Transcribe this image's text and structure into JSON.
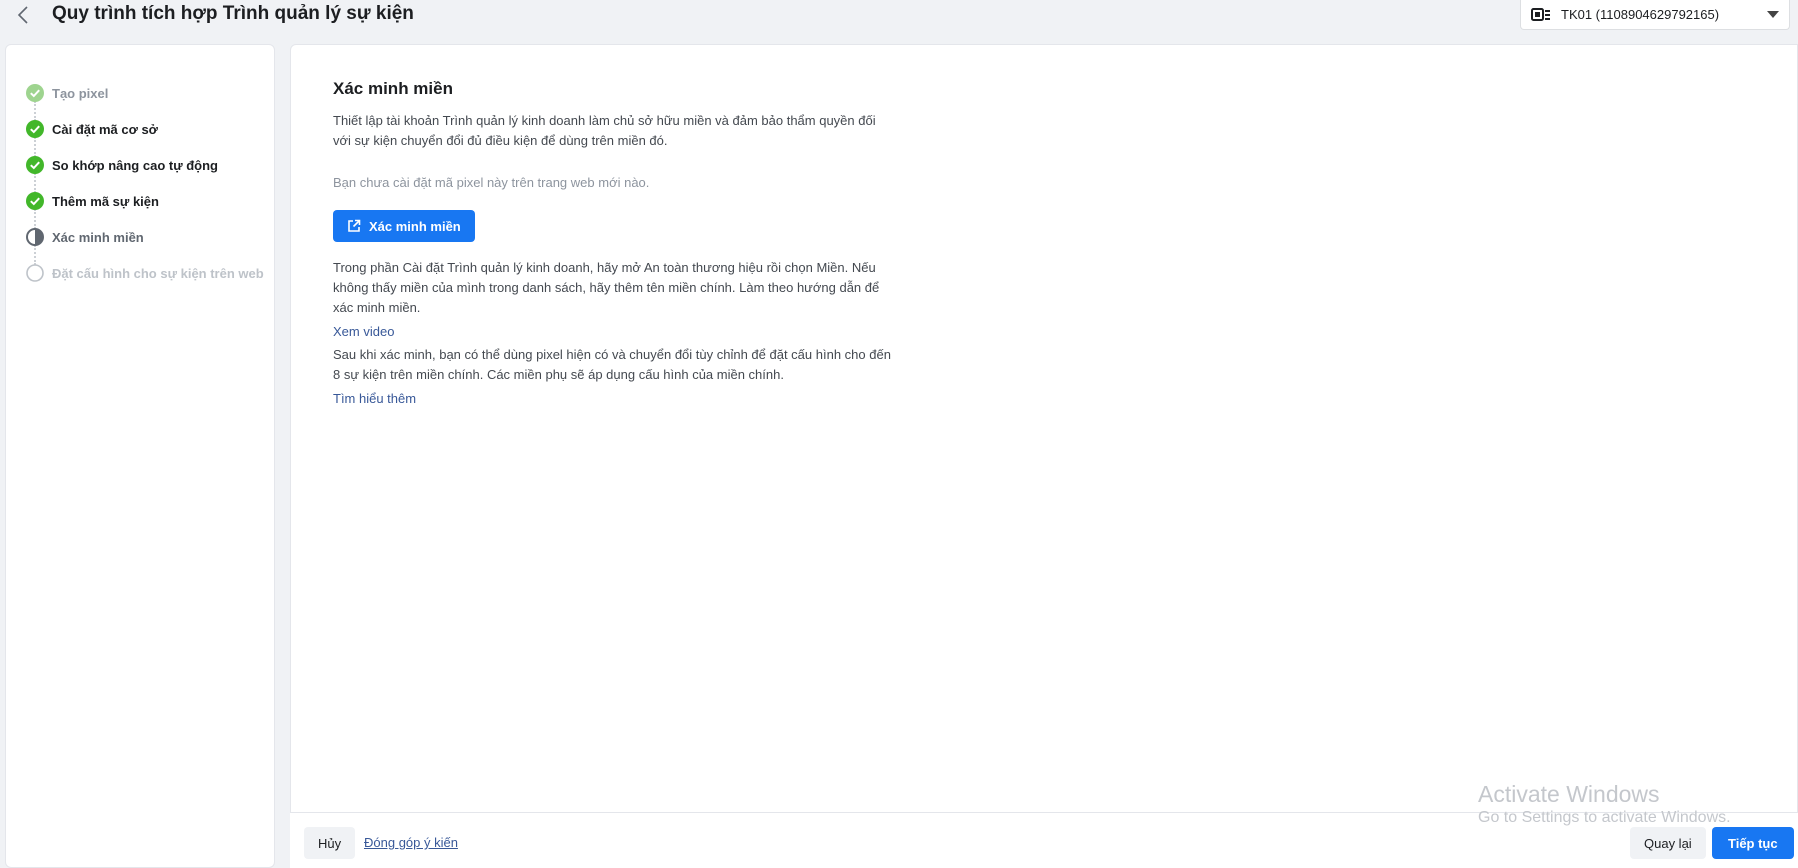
{
  "header": {
    "title": "Quy trình tích hợp Trình quản lý sự kiện",
    "account": "TK01 (1108904629792165)"
  },
  "steps": [
    {
      "label": "Tạo pixel",
      "state": "faded"
    },
    {
      "label": "Cài đặt mã cơ sở",
      "state": "done"
    },
    {
      "label": "So khớp nâng cao tự động",
      "state": "done"
    },
    {
      "label": "Thêm mã sự kiện",
      "state": "done"
    },
    {
      "label": "Xác minh miền",
      "state": "current"
    },
    {
      "label": "Đặt cấu hình cho sự kiện trên web",
      "state": "pending"
    }
  ],
  "main": {
    "title": "Xác minh miền",
    "intro": "Thiết lập tài khoản Trình quản lý kinh doanh làm chủ sở hữu miền và đảm bảo thẩm quyền đối với sự kiện chuyển đổi đủ điều kiện để dùng trên miền đó.",
    "hint": "Bạn chưa cài đặt mã pixel này trên trang web mới nào.",
    "verify_button": "Xác minh miền",
    "instructions": "Trong phần Cài đặt Trình quản lý kinh doanh, hãy mở An toàn thương hiệu rồi chọn Miền. Nếu không thấy miền của mình trong danh sách, hãy thêm tên miền chính. Làm theo hướng dẫn để xác minh miền.",
    "video_link": "Xem video",
    "after_verify": "Sau khi xác minh, bạn có thể dùng pixel hiện có và chuyển đổi tùy chỉnh để đặt cấu hình cho đến 8 sự kiện trên miền chính. Các miền phụ sẽ áp dụng cấu hình của miền chính.",
    "learn_more_link": "Tìm hiểu thêm"
  },
  "footer": {
    "cancel": "Hủy",
    "feedback": "Đóng góp ý kiến",
    "back": "Quay lại",
    "next": "Tiếp tục"
  },
  "watermark": {
    "line1": "Activate Windows",
    "line2": "Go to Settings to activate Windows."
  },
  "colors": {
    "primary": "#1877f2",
    "success": "#42b72a",
    "link": "#385898"
  }
}
